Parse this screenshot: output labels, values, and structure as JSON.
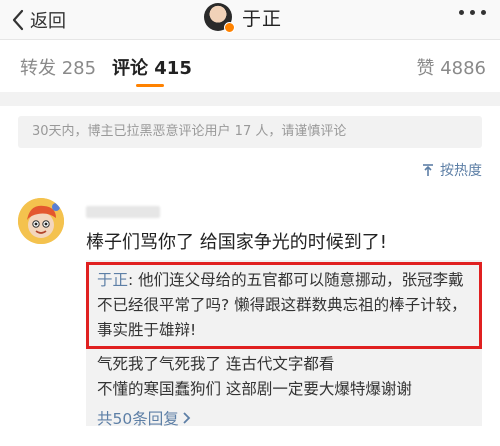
{
  "nav": {
    "back_label": "返回",
    "title": "于正",
    "accent": "#ff8200"
  },
  "tabs": {
    "forward_label": "转发",
    "forward_count": "285",
    "comment_label": "评论",
    "comment_count": "415",
    "like_label": "赞",
    "like_count": "4886"
  },
  "notice": {
    "text": "30天内，博主已拉黑恶意评论用户 17 人，请谨慎评论"
  },
  "sort": {
    "label": "按热度",
    "icon": "sort-icon"
  },
  "comment": {
    "text": "棒子们骂你了 给国家争光的时候到了!",
    "replies": [
      {
        "author": "于正",
        "text": ": 他们连父母给的五官都可以随意挪动，张冠李戴不已经很平常了吗? 懒得跟这群数典忘祖的棒子计较，事实胜于雄辩!",
        "highlight_color": "#e02020"
      },
      {
        "line1": "气死我了气死我了 连古代文字都看",
        "line2": "不懂的寒国蠢狗们 这部剧一定要大爆特爆谢谢"
      }
    ],
    "reply_count_label": "共50条回复"
  }
}
